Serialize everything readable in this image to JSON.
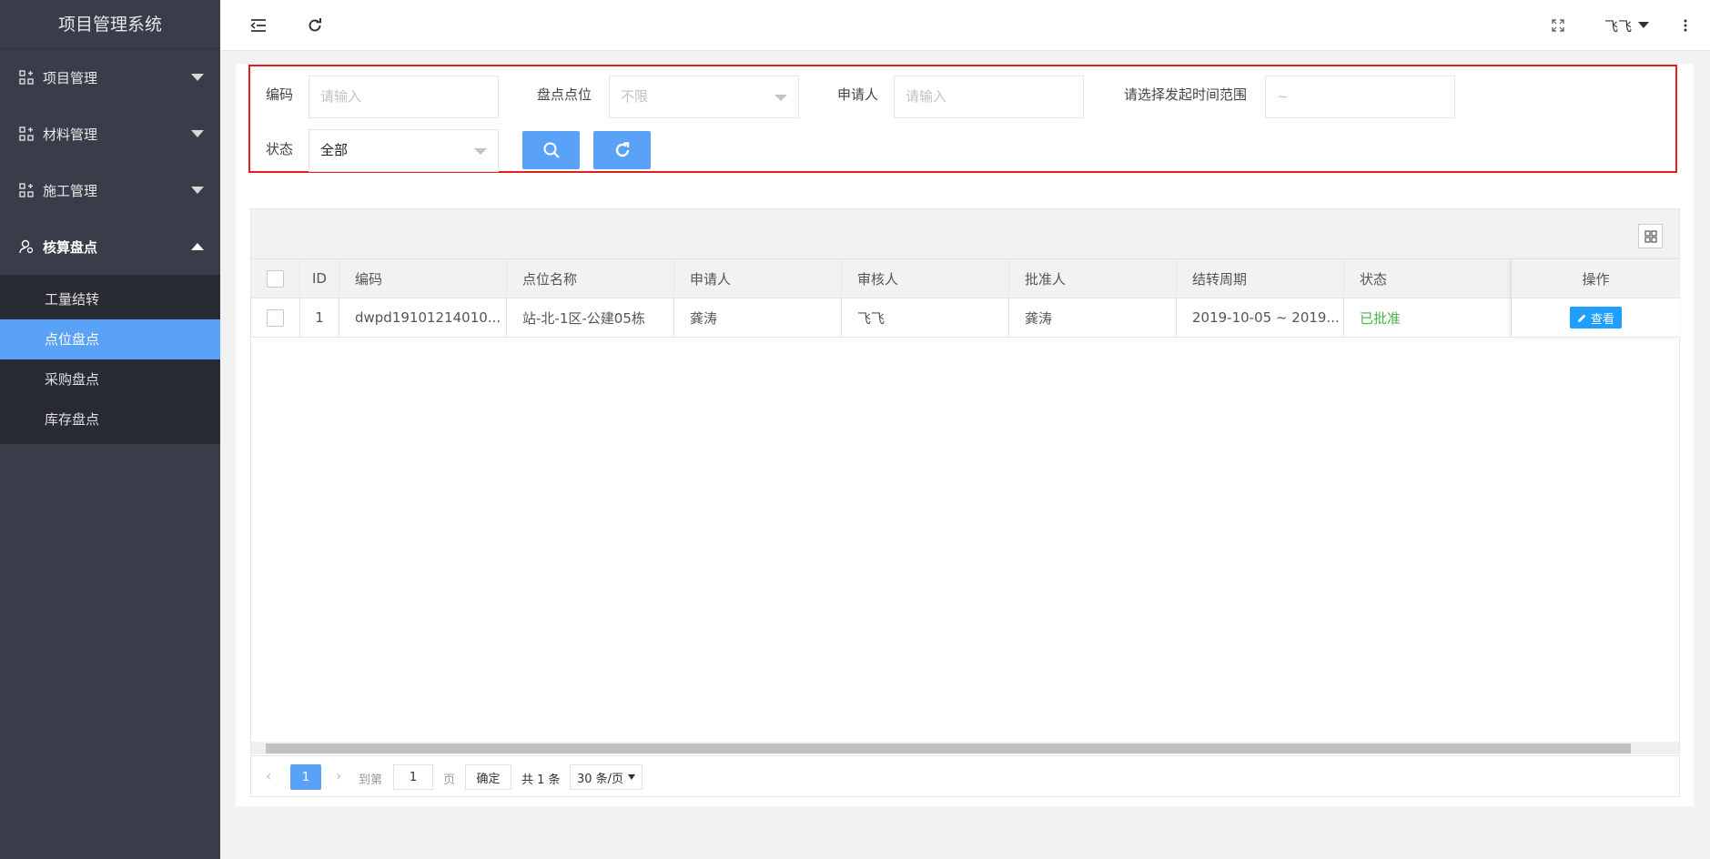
{
  "app": {
    "title": "项目管理系统"
  },
  "sidebar": {
    "groups": [
      {
        "label": "项目管理",
        "expanded": false
      },
      {
        "label": "材料管理",
        "expanded": false
      },
      {
        "label": "施工管理",
        "expanded": false
      },
      {
        "label": "核算盘点",
        "expanded": true
      }
    ],
    "subitems": [
      "工量结转",
      "点位盘点",
      "采购盘点",
      "库存盘点"
    ],
    "active_subitem": "点位盘点"
  },
  "topbar": {
    "user": "飞飞"
  },
  "filters": {
    "code_label": "编码",
    "code_placeholder": "请输入",
    "location_label": "盘点点位",
    "location_value": "不限",
    "applicant_label": "申请人",
    "applicant_placeholder": "请输入",
    "time_label": "请选择发起时间范围",
    "time_placeholder": "~",
    "status_label": "状态",
    "status_value": "全部"
  },
  "table": {
    "columns": [
      "ID",
      "编码",
      "点位名称",
      "申请人",
      "审核人",
      "批准人",
      "结转周期",
      "状态",
      "操作"
    ],
    "rows": [
      {
        "id": "1",
        "code": "dwpd19101214010...",
        "location": "站-北-1区-公建05栋",
        "applicant": "龚涛",
        "reviewer": "飞飞",
        "approver": "龚涛",
        "period": "2019-10-05 ~ 2019...",
        "status": "已批准",
        "action": "查看"
      }
    ]
  },
  "pagination": {
    "current_page": "1",
    "goto_label": "到第",
    "goto_value": "1",
    "page_suffix": "页",
    "confirm": "确定",
    "total": "共 1 条",
    "page_size": "30 条/页"
  },
  "colors": {
    "accent": "#5aa2f7",
    "sidebar": "#393d49",
    "highlight_border": "#e31e1e",
    "success": "#44b549"
  }
}
